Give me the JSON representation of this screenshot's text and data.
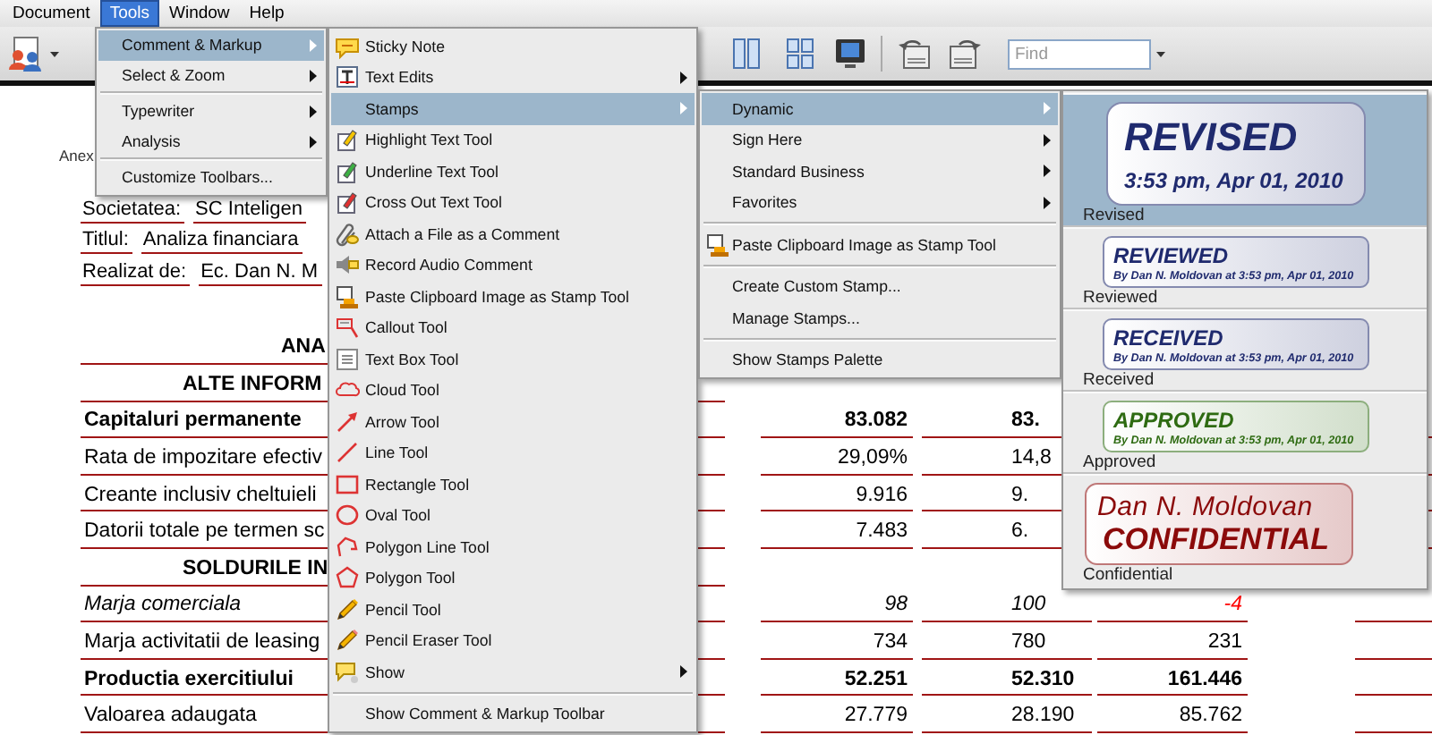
{
  "menu_bar": [
    {
      "label": "Document",
      "selected": false
    },
    {
      "label": "Tools",
      "selected": true
    },
    {
      "label": "Window",
      "selected": false
    },
    {
      "label": "Help",
      "selected": false
    }
  ],
  "toolbar": {
    "find": {
      "placeholder": "Find"
    }
  },
  "document": {
    "header_fragment": "Anex",
    "info_rows": [
      {
        "label": "Societatea:",
        "value": "SC Inteligen"
      },
      {
        "label": "Titlul:",
        "value": "Analiza financiara"
      },
      {
        "label": "Realizat de:",
        "value": "Ec. Dan N. M"
      }
    ],
    "table_rows": [
      {
        "kind": "title",
        "label": "ANA",
        "cells": []
      },
      {
        "kind": "section",
        "label": "ALTE INFORM",
        "cells": []
      },
      {
        "kind": "bold",
        "label": "Capitaluri permanente",
        "cells": [
          "83.082",
          "83."
        ]
      },
      {
        "kind": "normal",
        "label": "Rata de impozitare efectiv",
        "cells": [
          "29,09%",
          "14,8"
        ]
      },
      {
        "kind": "normal",
        "label": "Creante inclusiv cheltuieli",
        "cells": [
          "9.916",
          "9."
        ]
      },
      {
        "kind": "normal",
        "label": "Datorii totale pe termen sc",
        "cells": [
          "7.483",
          "6."
        ]
      },
      {
        "kind": "section",
        "label": "SOLDURILE IN",
        "cells": []
      },
      {
        "kind": "italic",
        "label": "Marja comerciala",
        "cells": [
          "98",
          "100",
          {
            "text": "-4",
            "color": "#ff0000"
          }
        ]
      },
      {
        "kind": "normal",
        "label": "Marja activitatii de leasing",
        "cells": [
          "734",
          "780",
          "231"
        ]
      },
      {
        "kind": "bold",
        "label": "Productia exercitiului",
        "cells": [
          "52.251",
          "52.310",
          "161.446"
        ]
      },
      {
        "kind": "normal",
        "label": "Valoarea adaugata",
        "cells": [
          "27.779",
          "28.190",
          "85.762"
        ]
      }
    ]
  },
  "tools_menu": {
    "items": [
      {
        "kind": "item",
        "label": "Comment & Markup",
        "submenu": true,
        "selected": true
      },
      {
        "kind": "item",
        "label": "Select & Zoom",
        "submenu": true,
        "selected": false
      },
      {
        "kind": "separator"
      },
      {
        "kind": "item",
        "label": "Typewriter",
        "submenu": true,
        "selected": false
      },
      {
        "kind": "item",
        "label": "Analysis",
        "submenu": true,
        "selected": false
      },
      {
        "kind": "separator"
      },
      {
        "kind": "item",
        "label": "Customize Toolbars...",
        "submenu": false,
        "selected": false
      }
    ]
  },
  "comment_markup_menu": {
    "items": [
      {
        "kind": "item",
        "label": "Sticky Note",
        "submenu": false,
        "selected": false
      },
      {
        "kind": "item",
        "label": "Text Edits",
        "submenu": true,
        "selected": false
      },
      {
        "kind": "item",
        "label": "Stamps",
        "submenu": true,
        "selected": true
      },
      {
        "kind": "item",
        "label": "Highlight Text Tool",
        "submenu": false,
        "selected": false
      },
      {
        "kind": "item",
        "label": "Underline Text Tool",
        "submenu": false,
        "selected": false
      },
      {
        "kind": "item",
        "label": "Cross Out Text Tool",
        "submenu": false,
        "selected": false
      },
      {
        "kind": "item",
        "label": "Attach a File as a Comment",
        "submenu": false,
        "selected": false
      },
      {
        "kind": "item",
        "label": "Record Audio Comment",
        "submenu": false,
        "selected": false
      },
      {
        "kind": "item",
        "label": "Paste Clipboard Image as Stamp Tool",
        "submenu": false,
        "selected": false
      },
      {
        "kind": "item",
        "label": "Callout Tool",
        "submenu": false,
        "selected": false
      },
      {
        "kind": "item",
        "label": "Text Box Tool",
        "submenu": false,
        "selected": false
      },
      {
        "kind": "item",
        "label": "Cloud Tool",
        "submenu": false,
        "selected": false
      },
      {
        "kind": "item",
        "label": "Arrow Tool",
        "submenu": false,
        "selected": false
      },
      {
        "kind": "item",
        "label": "Line Tool",
        "submenu": false,
        "selected": false
      },
      {
        "kind": "item",
        "label": "Rectangle Tool",
        "submenu": false,
        "selected": false
      },
      {
        "kind": "item",
        "label": "Oval Tool",
        "submenu": false,
        "selected": false
      },
      {
        "kind": "item",
        "label": "Polygon Line Tool",
        "submenu": false,
        "selected": false
      },
      {
        "kind": "item",
        "label": "Polygon Tool",
        "submenu": false,
        "selected": false
      },
      {
        "kind": "item",
        "label": "Pencil Tool",
        "submenu": false,
        "selected": false
      },
      {
        "kind": "item",
        "label": "Pencil Eraser Tool",
        "submenu": false,
        "selected": false
      },
      {
        "kind": "item",
        "label": "Show",
        "submenu": true,
        "selected": false
      },
      {
        "kind": "separator"
      },
      {
        "kind": "item",
        "label": "Show Comment & Markup Toolbar",
        "submenu": false,
        "selected": false
      }
    ]
  },
  "stamps_menu": {
    "items": [
      {
        "kind": "item",
        "label": "Dynamic",
        "submenu": true,
        "selected": true
      },
      {
        "kind": "item",
        "label": "Sign Here",
        "submenu": true,
        "selected": false
      },
      {
        "kind": "item",
        "label": "Standard Business",
        "submenu": true,
        "selected": false
      },
      {
        "kind": "item",
        "label": "Favorites",
        "submenu": true,
        "selected": false
      },
      {
        "kind": "separator"
      },
      {
        "kind": "item",
        "label": "Paste Clipboard Image as Stamp Tool",
        "submenu": false,
        "selected": false
      },
      {
        "kind": "separator"
      },
      {
        "kind": "item",
        "label": "Create Custom Stamp...",
        "submenu": false,
        "selected": false
      },
      {
        "kind": "item",
        "label": "Manage Stamps...",
        "submenu": false,
        "selected": false
      },
      {
        "kind": "separator"
      },
      {
        "kind": "item",
        "label": "Show Stamps Palette",
        "submenu": false,
        "selected": false
      }
    ]
  },
  "dynamic_stamps": [
    {
      "kind": "large",
      "lines": [
        "REVISED",
        "3:53 pm, Apr 01, 2010"
      ],
      "caption": "Revised",
      "color": "#1f2a6e",
      "selected": true
    },
    {
      "kind": "standard",
      "lines": [
        "REVIEWED",
        "By Dan N. Moldovan at 3:53 pm, Apr 01, 2010"
      ],
      "caption": "Reviewed",
      "color": "#1f2a6e",
      "selected": false
    },
    {
      "kind": "standard",
      "lines": [
        "RECEIVED",
        "By Dan N. Moldovan at 3:53 pm, Apr 01, 2010"
      ],
      "caption": "Received",
      "color": "#1f2a6e",
      "selected": false
    },
    {
      "kind": "standard",
      "lines": [
        "APPROVED",
        "By Dan N. Moldovan at 3:53 pm, Apr 01, 2010"
      ],
      "caption": "Approved",
      "color": "#2e6b12",
      "selected": false
    },
    {
      "kind": "confidential",
      "lines": [
        "Dan N. Moldovan",
        "CONFIDENTIAL"
      ],
      "caption": "Confidential",
      "color": "#8b0a0a",
      "selected": false
    }
  ]
}
